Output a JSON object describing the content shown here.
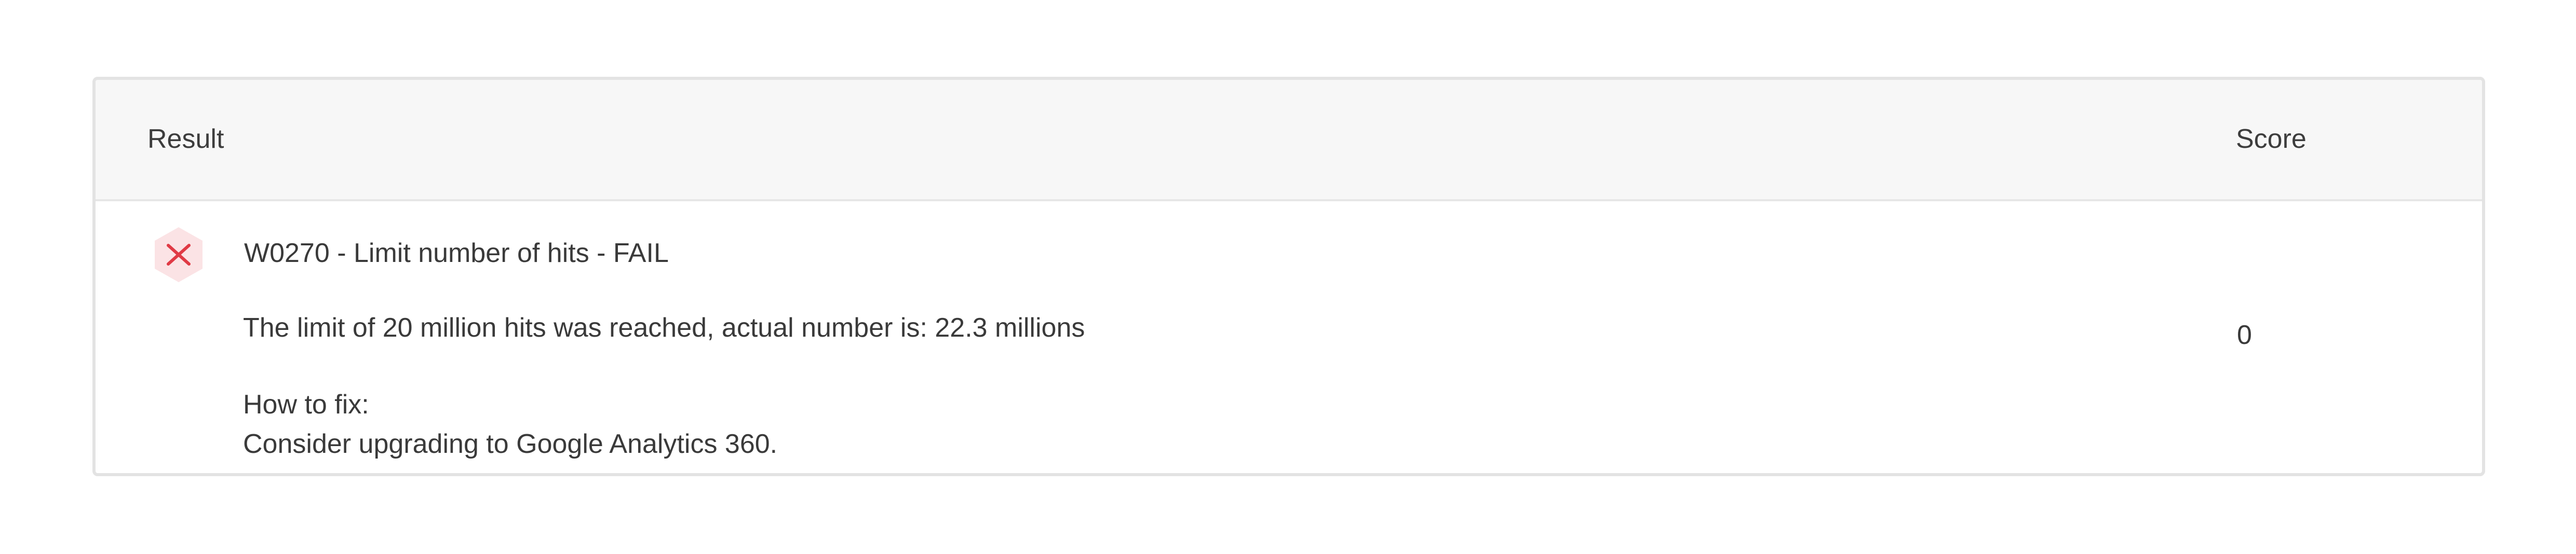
{
  "colors": {
    "fail_accent": "#e03a45",
    "fail_icon_bg": "#fbe3e5",
    "header_bg": "#f7f7f7",
    "border": "#e3e3e3"
  },
  "table": {
    "headers": {
      "result": "Result",
      "score": "Score"
    },
    "rows": [
      {
        "status_icon": "fail-x-icon",
        "status": "FAIL",
        "title": "W0270 - Limit number of hits - FAIL",
        "message": "The limit of 20 million hits was reached, actual number is: 22.3 millions",
        "fix_label": "How to fix:",
        "fix_text": "Consider upgrading to Google Analytics 360.",
        "score": "0"
      }
    ]
  }
}
